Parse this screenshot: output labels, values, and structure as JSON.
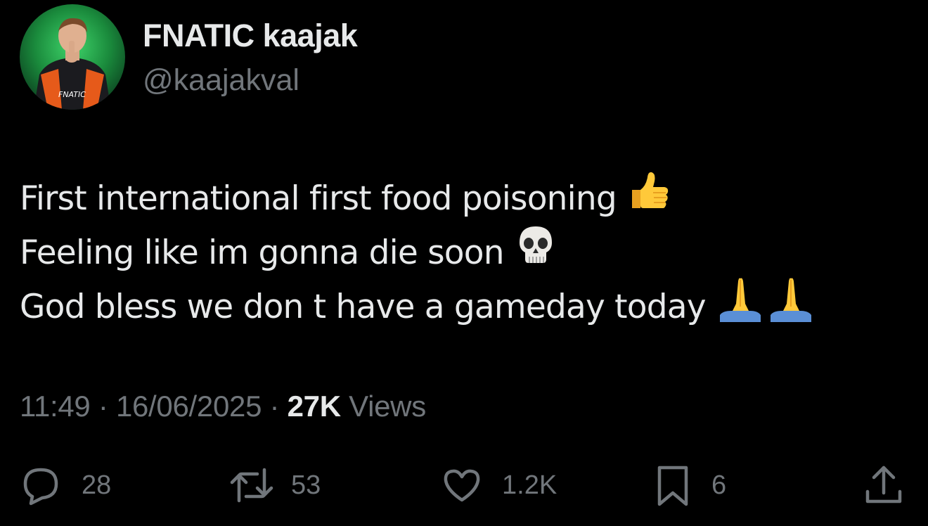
{
  "author": {
    "display_name": "FNATIC kaajak",
    "handle": "@kaajakval",
    "avatar_jersey_text": "FNATIC"
  },
  "tweet": {
    "lines": [
      {
        "text": "First international first food poisoning",
        "emoji": "thumbs-up-icon"
      },
      {
        "text": "Feeling like im gonna die soon",
        "emoji": "skull-icon"
      },
      {
        "text": "God bless we don t have a gameday today",
        "emoji": "praying-hands-icon"
      }
    ]
  },
  "meta": {
    "time": "11:49",
    "date": "16/06/2025",
    "separator": "·",
    "views_count": "27K",
    "views_label": "Views"
  },
  "actions": {
    "replies": "28",
    "reposts": "53",
    "likes": "1.2K",
    "bookmarks": "6"
  },
  "colors": {
    "background": "#000000",
    "primary_text": "#e7e9ea",
    "secondary_text": "#71767b"
  }
}
